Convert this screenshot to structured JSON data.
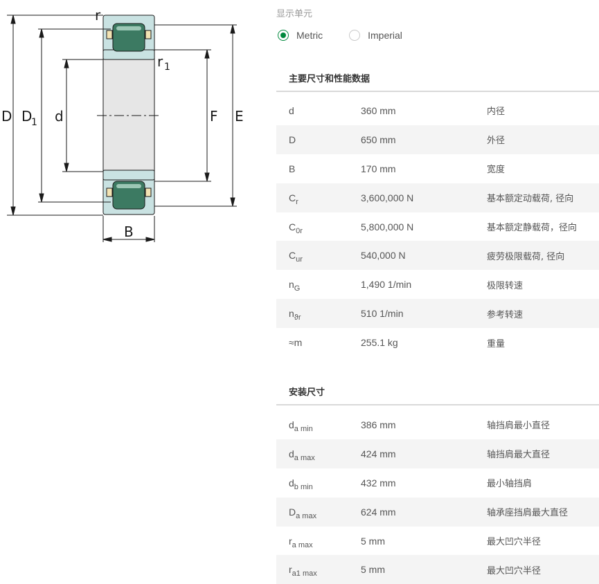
{
  "drawing": {
    "labels": {
      "r": "r",
      "r1_main": "r",
      "r1_sub": "1",
      "D": "D",
      "D1_main": "D",
      "D1_sub": "1",
      "d": "d",
      "F": "F",
      "E": "E",
      "B": "B"
    },
    "colors": {
      "ring": "#c9e2e2",
      "bore": "#e6e6e6",
      "roller": "#3c7a62",
      "cage": "#f3e3b3",
      "line": "#1a1a1a"
    }
  },
  "units": {
    "title": "显示单元",
    "options": [
      {
        "label": "Metric",
        "checked": true
      },
      {
        "label": "Imperial",
        "checked": false
      }
    ],
    "accent": "#00893d"
  },
  "main_dims": {
    "title": "主要尺寸和性能数据",
    "rows": [
      {
        "sym": "d",
        "sub": "",
        "value": "360 mm",
        "desc": "内径"
      },
      {
        "sym": "D",
        "sub": "",
        "value": "650 mm",
        "desc": "外径"
      },
      {
        "sym": "B",
        "sub": "",
        "value": "170 mm",
        "desc": "宽度"
      },
      {
        "sym": "C",
        "sub": "r",
        "value": "3,600,000 N",
        "desc": "基本额定动载荷, 径向"
      },
      {
        "sym": "C",
        "sub": "0r",
        "value": "5,800,000 N",
        "desc": "基本额定静载荷，径向"
      },
      {
        "sym": "C",
        "sub": "ur",
        "value": "540,000 N",
        "desc": "疲劳极限载荷, 径向"
      },
      {
        "sym": "n",
        "sub": "G",
        "value": "1,490 1/min",
        "desc": "极限转速"
      },
      {
        "sym": "n",
        "sub": "ϑr",
        "value": "510 1/min",
        "desc": "参考转速"
      },
      {
        "sym": "≈m",
        "sub": "",
        "value": "255.1 kg",
        "desc": "重量"
      }
    ]
  },
  "mount_dims": {
    "title": "安装尺寸",
    "rows": [
      {
        "sym": "d",
        "sub": "a min",
        "value": "386 mm",
        "desc": "轴挡肩最小直径"
      },
      {
        "sym": "d",
        "sub": "a max",
        "value": "424 mm",
        "desc": "轴挡肩最大直径"
      },
      {
        "sym": "d",
        "sub": "b min",
        "value": "432 mm",
        "desc": "最小轴挡肩"
      },
      {
        "sym": "D",
        "sub": "a max",
        "value": "624 mm",
        "desc": "轴承座挡肩最大直径"
      },
      {
        "sym": "r",
        "sub": "a max",
        "value": "5 mm",
        "desc": "最大凹穴半径"
      },
      {
        "sym": "r",
        "sub": "a1 max",
        "value": "5 mm",
        "desc": "最大凹穴半径"
      }
    ]
  }
}
